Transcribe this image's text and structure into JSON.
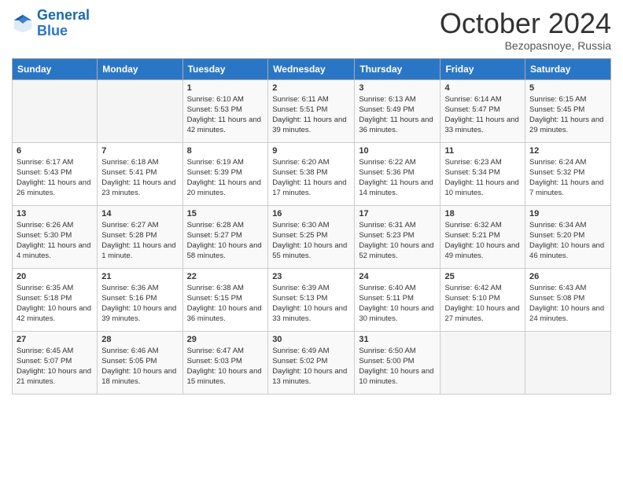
{
  "header": {
    "logo_line1": "General",
    "logo_line2": "Blue",
    "month_title": "October 2024",
    "location": "Bezopasnoye, Russia"
  },
  "weekdays": [
    "Sunday",
    "Monday",
    "Tuesday",
    "Wednesday",
    "Thursday",
    "Friday",
    "Saturday"
  ],
  "weeks": [
    [
      {
        "day": "",
        "sunrise": "",
        "sunset": "",
        "daylight": ""
      },
      {
        "day": "",
        "sunrise": "",
        "sunset": "",
        "daylight": ""
      },
      {
        "day": "1",
        "sunrise": "Sunrise: 6:10 AM",
        "sunset": "Sunset: 5:53 PM",
        "daylight": "Daylight: 11 hours and 42 minutes."
      },
      {
        "day": "2",
        "sunrise": "Sunrise: 6:11 AM",
        "sunset": "Sunset: 5:51 PM",
        "daylight": "Daylight: 11 hours and 39 minutes."
      },
      {
        "day": "3",
        "sunrise": "Sunrise: 6:13 AM",
        "sunset": "Sunset: 5:49 PM",
        "daylight": "Daylight: 11 hours and 36 minutes."
      },
      {
        "day": "4",
        "sunrise": "Sunrise: 6:14 AM",
        "sunset": "Sunset: 5:47 PM",
        "daylight": "Daylight: 11 hours and 33 minutes."
      },
      {
        "day": "5",
        "sunrise": "Sunrise: 6:15 AM",
        "sunset": "Sunset: 5:45 PM",
        "daylight": "Daylight: 11 hours and 29 minutes."
      }
    ],
    [
      {
        "day": "6",
        "sunrise": "Sunrise: 6:17 AM",
        "sunset": "Sunset: 5:43 PM",
        "daylight": "Daylight: 11 hours and 26 minutes."
      },
      {
        "day": "7",
        "sunrise": "Sunrise: 6:18 AM",
        "sunset": "Sunset: 5:41 PM",
        "daylight": "Daylight: 11 hours and 23 minutes."
      },
      {
        "day": "8",
        "sunrise": "Sunrise: 6:19 AM",
        "sunset": "Sunset: 5:39 PM",
        "daylight": "Daylight: 11 hours and 20 minutes."
      },
      {
        "day": "9",
        "sunrise": "Sunrise: 6:20 AM",
        "sunset": "Sunset: 5:38 PM",
        "daylight": "Daylight: 11 hours and 17 minutes."
      },
      {
        "day": "10",
        "sunrise": "Sunrise: 6:22 AM",
        "sunset": "Sunset: 5:36 PM",
        "daylight": "Daylight: 11 hours and 14 minutes."
      },
      {
        "day": "11",
        "sunrise": "Sunrise: 6:23 AM",
        "sunset": "Sunset: 5:34 PM",
        "daylight": "Daylight: 11 hours and 10 minutes."
      },
      {
        "day": "12",
        "sunrise": "Sunrise: 6:24 AM",
        "sunset": "Sunset: 5:32 PM",
        "daylight": "Daylight: 11 hours and 7 minutes."
      }
    ],
    [
      {
        "day": "13",
        "sunrise": "Sunrise: 6:26 AM",
        "sunset": "Sunset: 5:30 PM",
        "daylight": "Daylight: 11 hours and 4 minutes."
      },
      {
        "day": "14",
        "sunrise": "Sunrise: 6:27 AM",
        "sunset": "Sunset: 5:28 PM",
        "daylight": "Daylight: 11 hours and 1 minute."
      },
      {
        "day": "15",
        "sunrise": "Sunrise: 6:28 AM",
        "sunset": "Sunset: 5:27 PM",
        "daylight": "Daylight: 10 hours and 58 minutes."
      },
      {
        "day": "16",
        "sunrise": "Sunrise: 6:30 AM",
        "sunset": "Sunset: 5:25 PM",
        "daylight": "Daylight: 10 hours and 55 minutes."
      },
      {
        "day": "17",
        "sunrise": "Sunrise: 6:31 AM",
        "sunset": "Sunset: 5:23 PM",
        "daylight": "Daylight: 10 hours and 52 minutes."
      },
      {
        "day": "18",
        "sunrise": "Sunrise: 6:32 AM",
        "sunset": "Sunset: 5:21 PM",
        "daylight": "Daylight: 10 hours and 49 minutes."
      },
      {
        "day": "19",
        "sunrise": "Sunrise: 6:34 AM",
        "sunset": "Sunset: 5:20 PM",
        "daylight": "Daylight: 10 hours and 46 minutes."
      }
    ],
    [
      {
        "day": "20",
        "sunrise": "Sunrise: 6:35 AM",
        "sunset": "Sunset: 5:18 PM",
        "daylight": "Daylight: 10 hours and 42 minutes."
      },
      {
        "day": "21",
        "sunrise": "Sunrise: 6:36 AM",
        "sunset": "Sunset: 5:16 PM",
        "daylight": "Daylight: 10 hours and 39 minutes."
      },
      {
        "day": "22",
        "sunrise": "Sunrise: 6:38 AM",
        "sunset": "Sunset: 5:15 PM",
        "daylight": "Daylight: 10 hours and 36 minutes."
      },
      {
        "day": "23",
        "sunrise": "Sunrise: 6:39 AM",
        "sunset": "Sunset: 5:13 PM",
        "daylight": "Daylight: 10 hours and 33 minutes."
      },
      {
        "day": "24",
        "sunrise": "Sunrise: 6:40 AM",
        "sunset": "Sunset: 5:11 PM",
        "daylight": "Daylight: 10 hours and 30 minutes."
      },
      {
        "day": "25",
        "sunrise": "Sunrise: 6:42 AM",
        "sunset": "Sunset: 5:10 PM",
        "daylight": "Daylight: 10 hours and 27 minutes."
      },
      {
        "day": "26",
        "sunrise": "Sunrise: 6:43 AM",
        "sunset": "Sunset: 5:08 PM",
        "daylight": "Daylight: 10 hours and 24 minutes."
      }
    ],
    [
      {
        "day": "27",
        "sunrise": "Sunrise: 6:45 AM",
        "sunset": "Sunset: 5:07 PM",
        "daylight": "Daylight: 10 hours and 21 minutes."
      },
      {
        "day": "28",
        "sunrise": "Sunrise: 6:46 AM",
        "sunset": "Sunset: 5:05 PM",
        "daylight": "Daylight: 10 hours and 18 minutes."
      },
      {
        "day": "29",
        "sunrise": "Sunrise: 6:47 AM",
        "sunset": "Sunset: 5:03 PM",
        "daylight": "Daylight: 10 hours and 15 minutes."
      },
      {
        "day": "30",
        "sunrise": "Sunrise: 6:49 AM",
        "sunset": "Sunset: 5:02 PM",
        "daylight": "Daylight: 10 hours and 13 minutes."
      },
      {
        "day": "31",
        "sunrise": "Sunrise: 6:50 AM",
        "sunset": "Sunset: 5:00 PM",
        "daylight": "Daylight: 10 hours and 10 minutes."
      },
      {
        "day": "",
        "sunrise": "",
        "sunset": "",
        "daylight": ""
      },
      {
        "day": "",
        "sunrise": "",
        "sunset": "",
        "daylight": ""
      }
    ]
  ]
}
